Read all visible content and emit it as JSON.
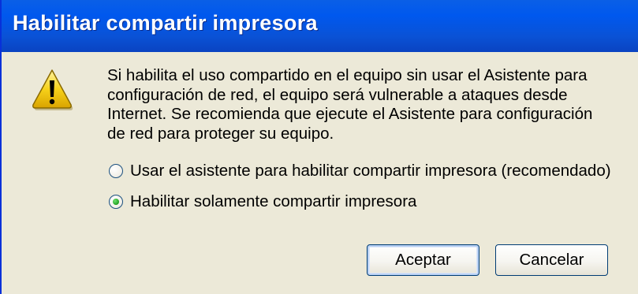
{
  "window": {
    "title": "Habilitar compartir impresora"
  },
  "icon": {
    "type": "warning-icon",
    "glyph": "!",
    "color": "#f5c400"
  },
  "message": {
    "lines": [
      "Si habilita el uso compartido en el equipo sin usar el Asistente para",
      "configuración de red, el equipo será vulnerable a ataques desde",
      "Internet. Se recomienda que ejecute el Asistente para configuración",
      "de red para proteger su equipo."
    ]
  },
  "options": [
    {
      "label": "Usar el asistente para habilitar compartir impresora (recomendado)",
      "selected": false
    },
    {
      "label": "Habilitar solamente compartir impresora",
      "selected": true
    }
  ],
  "buttons": {
    "ok": "Aceptar",
    "cancel": "Cancelar"
  },
  "colors": {
    "titlebar": "#0a52d6",
    "dialog_bg": "#ece9d8",
    "radio_selected": "#21a121"
  }
}
